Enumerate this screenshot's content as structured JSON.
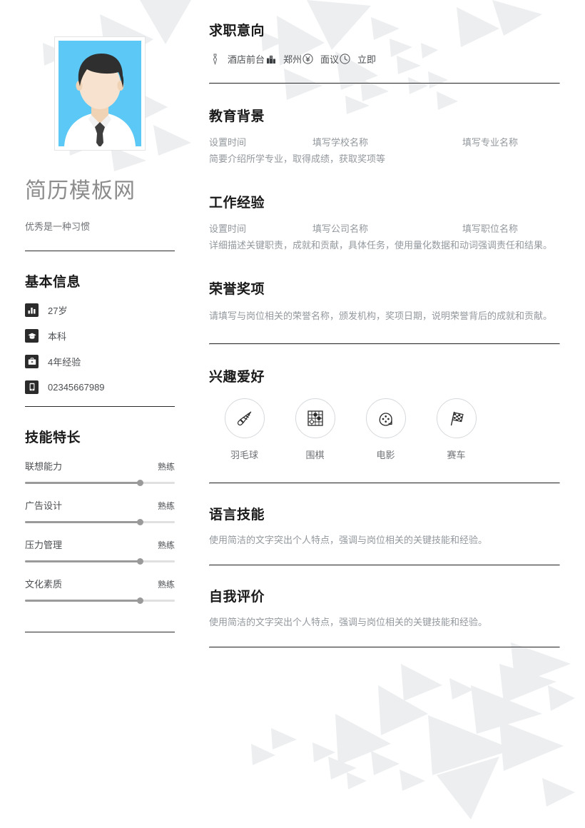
{
  "theme": {
    "heading_color": "#1a1a1a",
    "muted_text_color": "#93989d",
    "body_text_color": "#4c4f52",
    "name_color": "#8c8c8c",
    "rule_color": "#2b2b2b",
    "deco_triangle_color": "#eceef0",
    "avatar_bg_color": "#5bc8f5",
    "avatar_hair_color": "#2f2f2f",
    "avatar_skin_color": "#f3ddc6",
    "avatar_shirt_color": "#ffffff",
    "avatar_tie_color": "#3e3e3e",
    "skill_track_color": "#e0e0e0",
    "skill_fill_color": "#9a9a9a"
  },
  "profile": {
    "avatar_alt": "avatar-photo",
    "name": "简历模板网",
    "slogan": "优秀是一种习惯"
  },
  "basic_info": {
    "heading": "基本信息",
    "items": [
      {
        "icon": "bar-chart-icon",
        "text": "27岁"
      },
      {
        "icon": "graduation-cap-icon",
        "text": "本科"
      },
      {
        "icon": "briefcase-icon",
        "text": "4年经验"
      },
      {
        "icon": "mobile-phone-icon",
        "text": "02345667989"
      }
    ]
  },
  "skills": {
    "heading": "技能特长",
    "items": [
      {
        "name": "联想能力",
        "level": "熟练",
        "percent": 77
      },
      {
        "name": "广告设计",
        "level": "熟练",
        "percent": 77
      },
      {
        "name": "压力管理",
        "level": "熟练",
        "percent": 77
      },
      {
        "name": "文化素质",
        "level": "熟练",
        "percent": 77
      }
    ]
  },
  "job_intention": {
    "heading": "求职意向",
    "items": [
      {
        "icon": "necktie-icon",
        "text": "酒店前台"
      },
      {
        "icon": "building-icon",
        "text": "郑州"
      },
      {
        "icon": "yen-circle-icon",
        "text": "面议"
      },
      {
        "icon": "clock-icon",
        "text": "立即"
      }
    ]
  },
  "education": {
    "heading": "教育背景",
    "time": "设置时间",
    "school": "填写学校名称",
    "major": "填写专业名称",
    "description": "简要介绍所学专业，取得成绩，获取奖项等"
  },
  "work": {
    "heading": "工作经验",
    "time": "设置时间",
    "company": "填写公司名称",
    "position": "填写职位名称",
    "description": "详细描述关键职责，成就和贡献，具体任务，使用量化数据和动词强调责任和结果。"
  },
  "honors": {
    "heading": "荣誉奖项",
    "description": "请填写与岗位相关的荣誉名称，颁发机构，奖项日期，说明荣誉背后的成就和贡献。"
  },
  "hobbies": {
    "heading": "兴趣爱好",
    "items": [
      {
        "icon": "badminton-shuttlecock-icon",
        "label": "羽毛球"
      },
      {
        "icon": "go-board-icon",
        "label": "围棋"
      },
      {
        "icon": "film-reel-icon",
        "label": "电影"
      },
      {
        "icon": "racing-flag-icon",
        "label": "赛车"
      }
    ]
  },
  "language": {
    "heading": "语言技能",
    "description": "使用简洁的文字突出个人特点，强调与岗位相关的关键技能和经验。"
  },
  "self_evaluation": {
    "heading": "自我评价",
    "description": "使用简洁的文字突出个人特点，强调与岗位相关的关键技能和经验。"
  }
}
